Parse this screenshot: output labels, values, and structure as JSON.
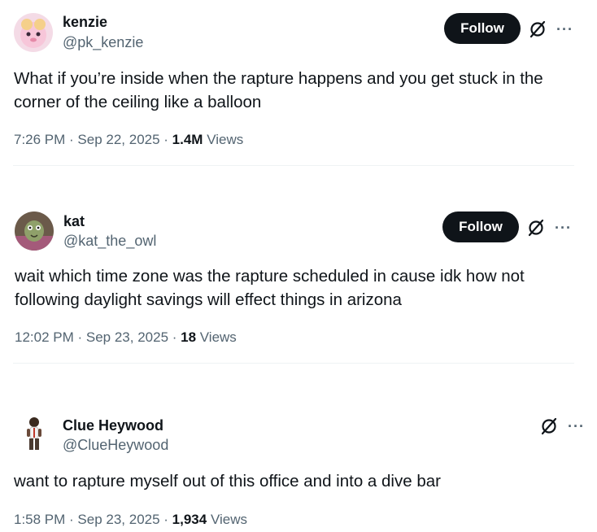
{
  "tweets": [
    {
      "name": "kenzie",
      "handle": "@pk_kenzie",
      "follow_label": "Follow",
      "text_line1": "What if you’re inside when the rapture happens and you get stuck in the",
      "text_line2": "corner of the ceiling like a balloon",
      "time": "7:26 PM · Sep 22, 2025 · ",
      "views_count": "1.4M",
      "views_label": " Views"
    },
    {
      "name": "kat",
      "handle": "@kat_the_owl",
      "follow_label": "Follow",
      "text_line1": "wait which time zone was the rapture scheduled in cause idk how not",
      "text_line2": "following daylight savings will effect things in arizona",
      "time": "12:02 PM · Sep 23, 2025 · ",
      "views_count": "18",
      "views_label": " Views"
    },
    {
      "name": "Clue Heywood",
      "handle": "@ClueHeywood",
      "text_line1": "want to rapture myself out of this office and into a dive bar",
      "time": "1:58 PM · Sep 23, 2025 · ",
      "views_count": "1,934",
      "views_label": " Views"
    }
  ],
  "icons": {
    "grok": "grok-slash-icon",
    "more": "more-dots-icon"
  },
  "more_glyph": "···",
  "colors": {
    "text": "#0f1419",
    "secondary": "#536471",
    "follow_bg": "#0f1419",
    "divider": "#eff3f4"
  }
}
